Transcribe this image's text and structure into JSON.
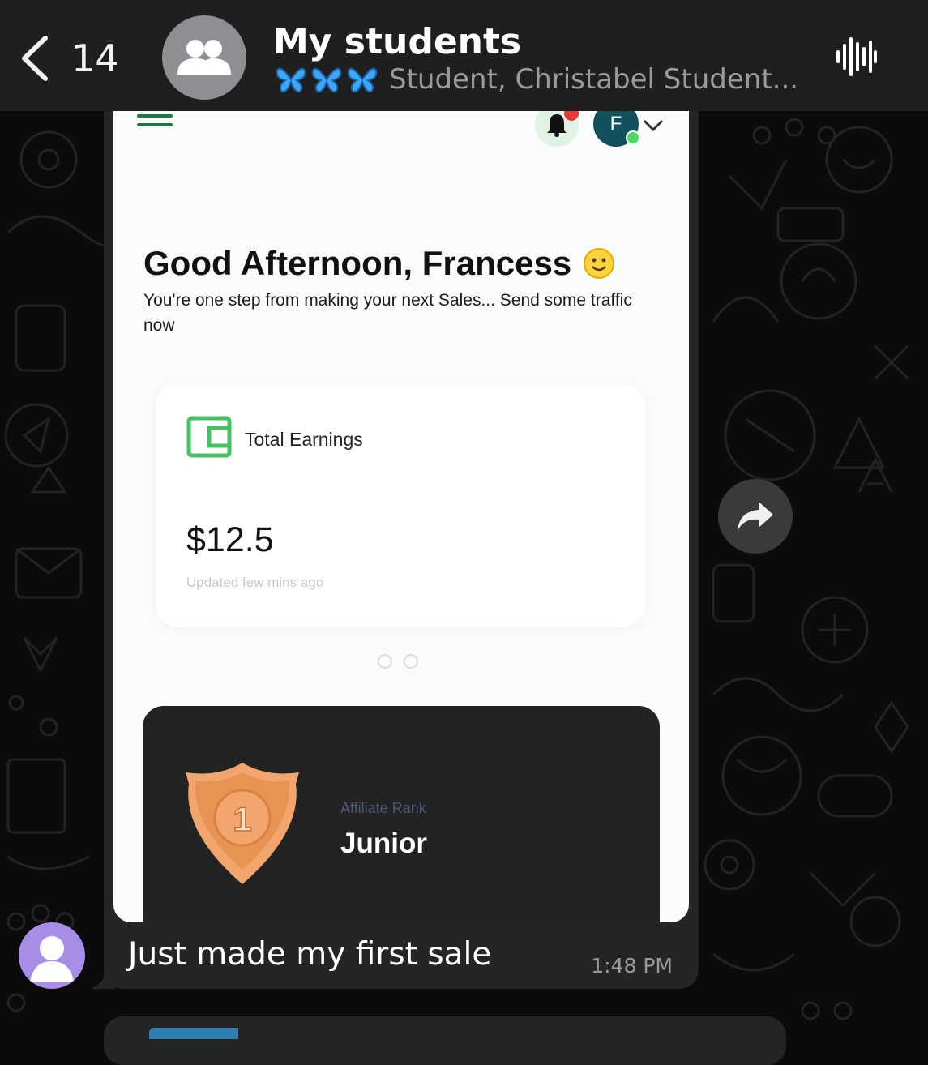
{
  "header": {
    "back_count": "14",
    "title": "My students",
    "butterflies": [
      "butterfly-emoji",
      "butterfly-emoji",
      "butterfly-emoji"
    ],
    "subtitle": "Student, Christabel Student..."
  },
  "screenshot": {
    "greeting": "Good Afternoon, Francess",
    "greeting_sub": "You're one step from making your next Sales... Send some traffic now",
    "avatar_initial": "F",
    "earnings": {
      "label": "Total Earnings",
      "amount": "$12.5",
      "updated": "Updated few mins ago"
    },
    "carousel_pages": 2,
    "rank": {
      "badge_number": "1",
      "label": "Affiliate Rank",
      "value": "Junior"
    }
  },
  "message": {
    "caption": "Just made my first sale",
    "time": "1:48 PM"
  },
  "colors": {
    "accent_green": "#1a7a3e",
    "wallet_green": "#44c25f",
    "badge_orange": "#f2a66e",
    "bubble": "#252525",
    "header": "#1f1f1f"
  }
}
